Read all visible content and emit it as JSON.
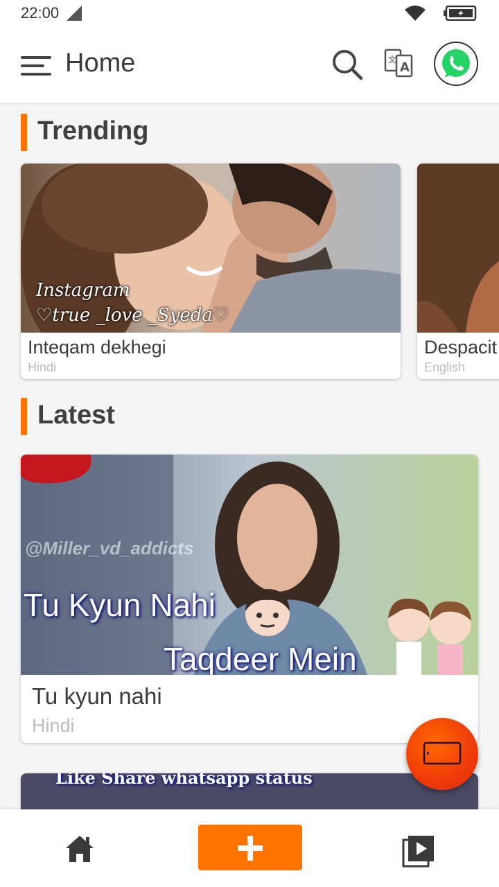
{
  "status_bar": {
    "time": "22:00"
  },
  "app_bar": {
    "title": "Home"
  },
  "sections": {
    "trending": {
      "title": "Trending",
      "cards": [
        {
          "title": "Inteqam dekhegi",
          "language": "Hindi",
          "overlay_line1": "Instagram",
          "overlay_line2": "♡true _love _Syeda♡"
        },
        {
          "title": "Despacit",
          "language": "English"
        }
      ]
    },
    "latest": {
      "title": "Latest",
      "cards": [
        {
          "title": "Tu kyun nahi",
          "language": "Hindi",
          "overlay_line1": "Tu Kyun Nahi",
          "overlay_line2": "Taqdeer Mein",
          "watermark": "@Miller_vd_addicts"
        },
        {
          "overlay_text": "Like Share whatsapp status"
        }
      ]
    }
  },
  "colors": {
    "accent": "#ff7400",
    "fab": "#f03a0a",
    "whatsapp": "#25d366"
  }
}
